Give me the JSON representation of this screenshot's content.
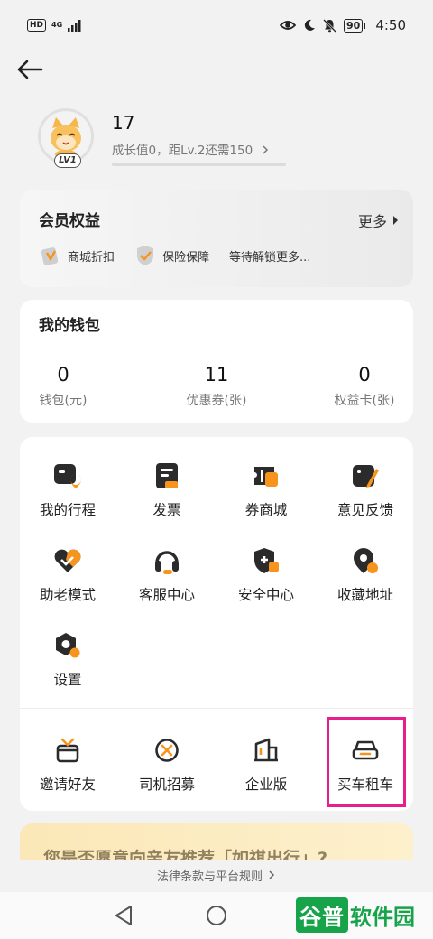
{
  "status_bar": {
    "hd": "HD",
    "net": "4G",
    "battery": "90",
    "time": "4:50"
  },
  "profile": {
    "level_badge": "LV1",
    "name": "17",
    "growth_text": "成长值0，距Lv.2还需150",
    "growth_progress": 0
  },
  "benefits": {
    "title": "会员权益",
    "more": "更多",
    "items": [
      {
        "label": "商城折扣",
        "icon": "shopping-tag-icon"
      },
      {
        "label": "保险保障",
        "icon": "shield-check-icon"
      }
    ],
    "pending": "等待解锁更多..."
  },
  "wallet": {
    "title": "我的钱包",
    "items": [
      {
        "value": "0",
        "label": "钱包(元)"
      },
      {
        "value": "11",
        "label": "优惠券(张)"
      },
      {
        "value": "0",
        "label": "权益卡(张)"
      }
    ]
  },
  "menu": {
    "items": [
      {
        "label": "我的行程",
        "icon": "trip-icon"
      },
      {
        "label": "发票",
        "icon": "invoice-icon"
      },
      {
        "label": "券商城",
        "icon": "coupon-mall-icon"
      },
      {
        "label": "意见反馈",
        "icon": "feedback-icon"
      },
      {
        "label": "助老模式",
        "icon": "elderly-mode-icon"
      },
      {
        "label": "客服中心",
        "icon": "headset-icon"
      },
      {
        "label": "安全中心",
        "icon": "security-shield-icon"
      },
      {
        "label": "收藏地址",
        "icon": "location-star-icon"
      },
      {
        "label": "设置",
        "icon": "settings-icon"
      }
    ],
    "extra_items": [
      {
        "label": "邀请好友",
        "icon": "gift-icon"
      },
      {
        "label": "司机招募",
        "icon": "steering-wheel-icon"
      },
      {
        "label": "企业版",
        "icon": "building-icon"
      },
      {
        "label": "买车租车",
        "icon": "car-icon"
      }
    ]
  },
  "promo": {
    "text": "您是否愿意向亲友推荐「如祺出行」?"
  },
  "footer": {
    "legal": "法律条款与平台规则"
  },
  "watermark": {
    "part_a": "谷普",
    "part_b": "软件园"
  },
  "colors": {
    "accent": "#f7941d",
    "icon_dark": "#2b2b2b",
    "highlight": "#e81e8c",
    "background": "#f2f2f2"
  }
}
